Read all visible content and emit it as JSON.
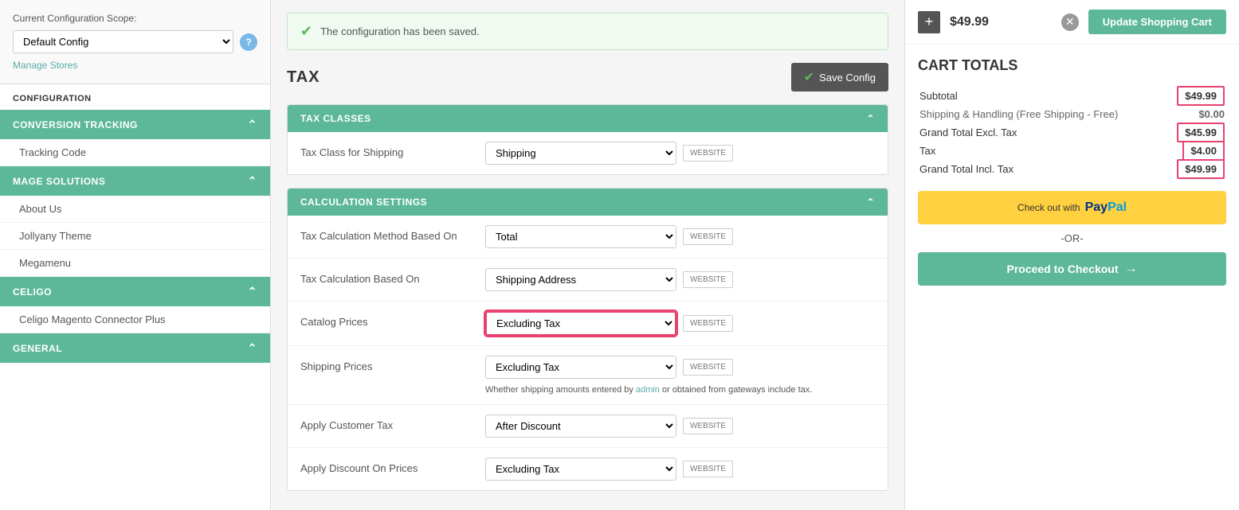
{
  "sidebar": {
    "scope_label": "Current Configuration Scope:",
    "default_config": "Default Config",
    "help_label": "?",
    "manage_stores": "Manage Stores",
    "section_title": "CONFIGURATION",
    "nav_items": [
      {
        "header": "CONVERSION TRACKING",
        "items": [
          "Tracking Code"
        ]
      },
      {
        "header": "MAGE SOLUTIONS",
        "items": [
          "About Us",
          "Jollyany Theme",
          "Megamenu"
        ]
      },
      {
        "header": "CELIGO",
        "items": [
          "Celigo Magento Connector Plus"
        ]
      },
      {
        "header": "GENERAL",
        "items": []
      }
    ]
  },
  "main": {
    "success_message": "The configuration has been saved.",
    "page_title": "TAX",
    "save_config_label": "Save Config",
    "panels": [
      {
        "header": "TAX CLASSES",
        "rows": [
          {
            "label": "Tax Class for Shipping",
            "value": "Shipping",
            "badge": "WEBSITE"
          }
        ]
      },
      {
        "header": "CALCULATION SETTINGS",
        "rows": [
          {
            "label": "Tax Calculation Method Based On",
            "value": "Total",
            "badge": "WEBSITE"
          },
          {
            "label": "Tax Calculation Based On",
            "value": "Shipping Address",
            "badge": "WEBSITE"
          },
          {
            "label": "Catalog Prices",
            "value": "Excluding Tax",
            "badge": "WEBSITE",
            "highlighted": true,
            "note": ""
          },
          {
            "label": "Shipping Prices",
            "value": "Excluding Tax",
            "badge": "WEBSITE",
            "note": "Whether shipping amounts entered by admin or obtained from gateways include tax."
          },
          {
            "label": "Apply Customer Tax",
            "value": "After Discount",
            "badge": "WEBSITE"
          },
          {
            "label": "Apply Discount On Prices",
            "value": "Excluding Tax",
            "badge": "WEBSITE"
          }
        ]
      }
    ]
  },
  "right": {
    "item_price": "$49.99",
    "update_cart_label": "Update Shopping Cart",
    "cart_totals_title": "CART TOTALS",
    "totals": [
      {
        "label": "Subtotal",
        "value": "$49.99",
        "highlighted": true
      },
      {
        "label": "Shipping & Handling (Free Shipping - Free)",
        "value": "$0.00",
        "highlighted": false
      },
      {
        "label": "Grand Total Excl. Tax",
        "value": "$45.99",
        "highlighted_group": true
      },
      {
        "label": "Tax",
        "value": "$4.00",
        "highlighted_group": true
      },
      {
        "label": "Grand Total Incl. Tax",
        "value": "$49.99",
        "highlighted_group": true
      }
    ],
    "paypal_btn_text": "Check out with",
    "paypal_text": "PayPal",
    "or_text": "-OR-",
    "checkout_label": "Proceed to Checkout",
    "checkout_arrow": "→"
  }
}
